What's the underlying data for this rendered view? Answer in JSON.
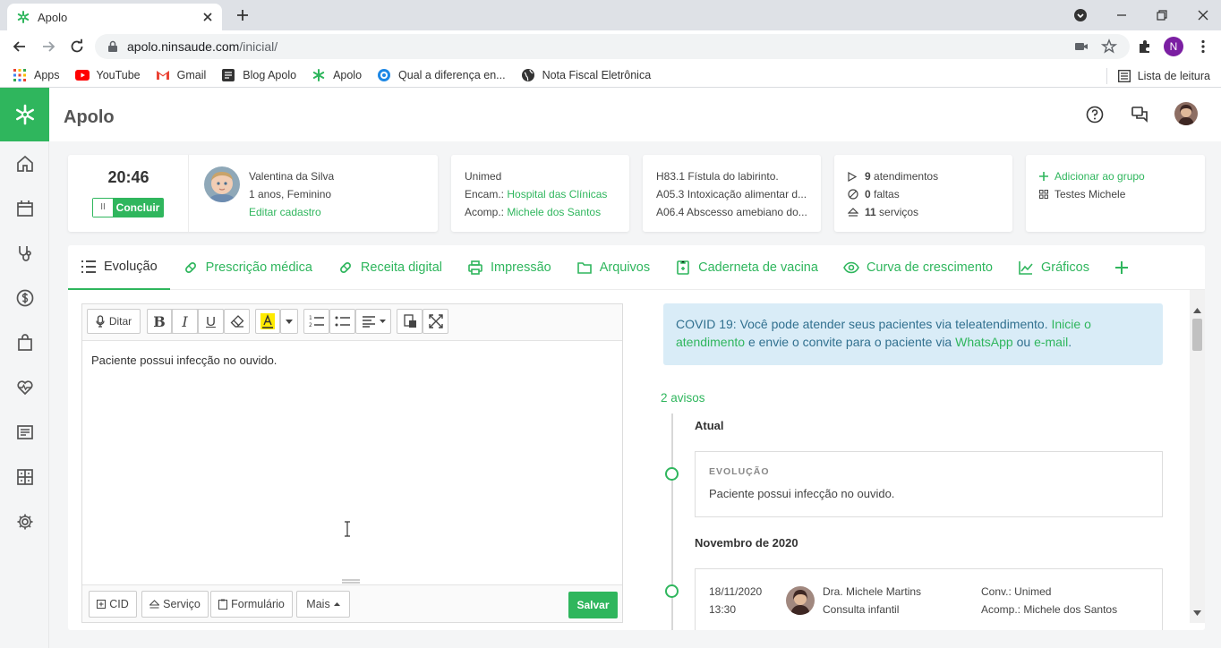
{
  "browser": {
    "tab_title": "Apolo",
    "url_host": "apolo.ninsaude.com",
    "url_path": "/inicial/",
    "profile_initial": "N",
    "bookmarks": [
      "Apps",
      "YouTube",
      "Gmail",
      "Blog Apolo",
      "Apolo",
      "Qual a diferença en...",
      "Nota Fiscal Eletrônica"
    ],
    "reading_list": "Lista de leitura"
  },
  "app": {
    "title": "Apolo",
    "brand_color": "#2fb65d"
  },
  "clock": {
    "time": "20:46",
    "pause_icon": "II",
    "finish_label": "Concluir"
  },
  "patient": {
    "name": "Valentina da Silva",
    "age_sex": "1 anos, Feminino",
    "edit_label": "Editar cadastro"
  },
  "insurance": {
    "name": "Unimed",
    "encam_label": "Encam.:",
    "encam_value": "Hospital das Clínicas",
    "acomp_label": "Acomp.:",
    "acomp_value": "Michele dos Santos"
  },
  "diagnoses": [
    "H83.1 Fístula do labirinto.",
    "A05.3 Intoxicação alimentar d...",
    "A06.4 Abscesso amebiano do..."
  ],
  "stats": {
    "atendimentos_count": "9",
    "atendimentos_label": "atendimentos",
    "faltas_count": "0",
    "faltas_label": "faltas",
    "servicos_count": "11",
    "servicos_label": "serviços"
  },
  "groups": {
    "add_label": "Adicionar ao grupo",
    "group_name": "Testes Michele"
  },
  "tabs": [
    {
      "label": "Evolução"
    },
    {
      "label": "Prescrição médica"
    },
    {
      "label": "Receita digital"
    },
    {
      "label": "Impressão"
    },
    {
      "label": "Arquivos"
    },
    {
      "label": "Caderneta de vacina"
    },
    {
      "label": "Curva de crescimento"
    },
    {
      "label": "Gráficos"
    }
  ],
  "editor": {
    "dictate_label": "Ditar",
    "content": "Paciente possui infecção no ouvido.",
    "cid_label": "CID",
    "servico_label": "Serviço",
    "formulario_label": "Formulário",
    "mais_label": "Mais",
    "save_label": "Salvar"
  },
  "notice": {
    "text1": "COVID 19: Você pode atender seus pacientes via teleatendimento.",
    "link1": "Inicie o atendimento",
    "text2": "e envie o convite para o paciente via",
    "link2": "WhatsApp",
    "text3": "ou",
    "link3": "e-mail",
    "text4": "."
  },
  "timeline": {
    "avisos": "2 avisos",
    "current_heading": "Atual",
    "evolution_label": "EVOLUÇÃO",
    "evolution_text": "Paciente possui infecção no ouvido.",
    "month_heading": "Novembro de 2020",
    "entry": {
      "date": "18/11/2020",
      "time": "13:30",
      "doctor": "Dra. Michele Martins",
      "type": "Consulta infantil",
      "conv": "Conv.: Unimed",
      "acomp": "Acomp.: Michele dos Santos"
    }
  }
}
